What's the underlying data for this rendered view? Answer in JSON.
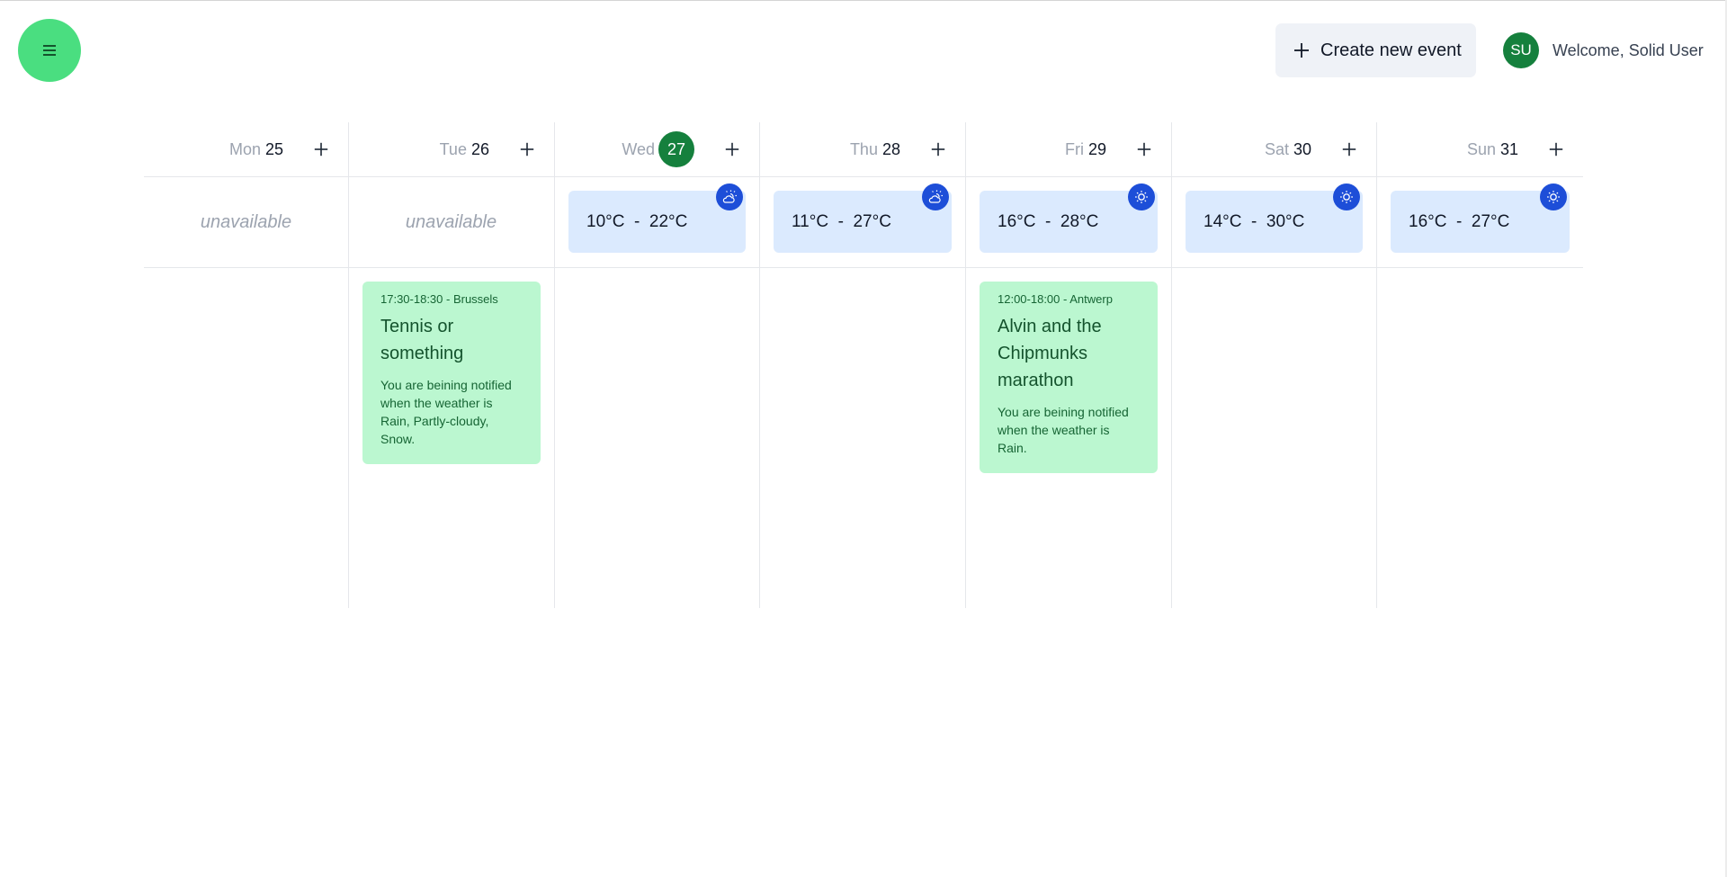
{
  "header": {
    "menu_icon": "hamburger-icon",
    "create_button": {
      "icon": "plus-icon",
      "label": "Create new event"
    },
    "user": {
      "initials": "SU",
      "welcome": "Welcome, Solid User"
    }
  },
  "colors": {
    "menu_button": "#4ade80",
    "today_badge": "#15803d",
    "avatar": "#15803d",
    "weather_card": "#dbeafe",
    "weather_badge": "#1d4ed8",
    "event_card": "#bbf7d0"
  },
  "week": {
    "days": [
      {
        "dow": "Mon",
        "num": "25",
        "today": false,
        "weather": null,
        "unavailable": "unavailable",
        "events": []
      },
      {
        "dow": "Tue",
        "num": "26",
        "today": false,
        "weather": null,
        "unavailable": "unavailable",
        "events": [
          {
            "meta": "17:30-18:30 - Brussels",
            "title": "Tennis or something",
            "note": "You are beining notified when the weather is Rain, Partly-cloudy, Snow."
          }
        ]
      },
      {
        "dow": "Wed",
        "num": "27",
        "today": true,
        "weather": {
          "range": "10°C  -  22°C",
          "icon": "partly-cloudy-icon"
        },
        "events": []
      },
      {
        "dow": "Thu",
        "num": "28",
        "today": false,
        "weather": {
          "range": "11°C  -  27°C",
          "icon": "partly-cloudy-icon"
        },
        "events": []
      },
      {
        "dow": "Fri",
        "num": "29",
        "today": false,
        "weather": {
          "range": "16°C  -  28°C",
          "icon": "sun-icon"
        },
        "events": [
          {
            "meta": "12:00-18:00 - Antwerp",
            "title": "Alvin and the Chipmunks marathon",
            "note": "You are beining notified when the weather is Rain."
          }
        ]
      },
      {
        "dow": "Sat",
        "num": "30",
        "today": false,
        "weather": {
          "range": "14°C  -  30°C",
          "icon": "sun-icon"
        },
        "events": []
      },
      {
        "dow": "Sun",
        "num": "31",
        "today": false,
        "weather": {
          "range": "16°C  -  27°C",
          "icon": "sun-icon"
        },
        "events": []
      }
    ]
  }
}
